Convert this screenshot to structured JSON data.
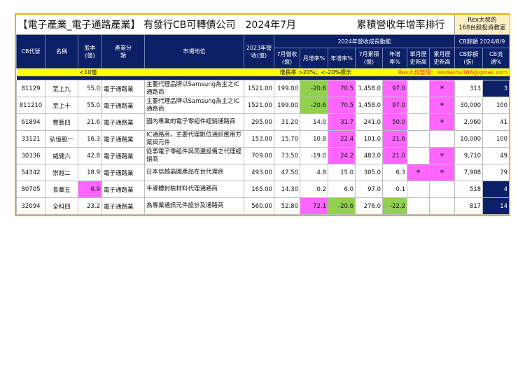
{
  "title": {
    "main": "【電子產業_電子通路產業】 有發行CB可轉債公司",
    "period": "2024年7月",
    "subject": "累積營收年增率排行",
    "brand_line1": "Rex大叔的",
    "brand_line2": "168台股投資教室"
  },
  "headers": {
    "cb_code": "CB代號",
    "name": "名稱",
    "capital": "股本(億)",
    "industry": "產業分類",
    "market": "市場地位",
    "rev2023": "2023年營收(億)",
    "growth_group": "2024年營收成長動能",
    "cb_group": "CB餘額 2024/8/9",
    "jul_rev": "7月營收(億)",
    "mom": "月增率%",
    "yoy": "年增率%",
    "jul_cum": "7月累積(億)",
    "cum_yoy": "年增率%",
    "month_high": "單月歷史新高",
    "cum_high": "累月歷史新高",
    "cb_balance": "CB餘額(張)",
    "cb_ratio": "CB流通%"
  },
  "legend": {
    "small_cap": "<10億",
    "rule": "增長率 >20%；<-20%標示",
    "credit": "Rex大叔整理：rexdashu168@gmail.com"
  },
  "colors": {
    "navy": "#0b2066",
    "magenta": "#ff66ff",
    "green": "#92d050",
    "yellow": "#ffff00",
    "border": "#e3b30c"
  },
  "rows": [
    {
      "code": "81129",
      "name": "至上九",
      "capital": "55.0",
      "industry": "電子通路業",
      "market": "主要代理品牌以Samsung為主之IC通路商",
      "rev2023": "1521.00",
      "jul_rev": "199.00",
      "mom": "-20.6",
      "yoy": "70.5",
      "jul_cum": "1,458.0",
      "cum_yoy": "97.0",
      "month_high": "",
      "cum_high": "*",
      "cb_balance": "313",
      "cb_ratio": "3",
      "hl": {
        "mom": "g",
        "yoy": "m",
        "cum_yoy": "m",
        "cum_high": "m",
        "cb_ratio": "n"
      }
    },
    {
      "code": "811210",
      "name": "至上十",
      "capital": "55.0",
      "industry": "電子通路業",
      "market": "主要代理品牌以Samsung為主之IC通路商",
      "rev2023": "1521.00",
      "jul_rev": "199.00",
      "mom": "-20.6",
      "yoy": "70.5",
      "jul_cum": "1,458.0",
      "cum_yoy": "97.0",
      "month_high": "",
      "cum_high": "*",
      "cb_balance": "30,000",
      "cb_ratio": "100",
      "hl": {
        "mom": "g",
        "yoy": "m",
        "cum_yoy": "m",
        "cum_high": "m"
      }
    },
    {
      "code": "61894",
      "name": "豐藝四",
      "capital": "21.6",
      "industry": "電子通路業",
      "market": "國內專業的電子零組件經銷通路商",
      "rev2023": "295.00",
      "jul_rev": "31.20",
      "mom": "14.0",
      "yoy": "31.7",
      "jul_cum": "241.0",
      "cum_yoy": "50.0",
      "month_high": "",
      "cum_high": "*",
      "cb_balance": "2,060",
      "cb_ratio": "41",
      "hl": {
        "yoy": "m",
        "cum_yoy": "m",
        "cum_high": "m"
      }
    },
    {
      "code": "33121",
      "name": "弘憶股一",
      "capital": "16.3",
      "industry": "電子通路業",
      "market": "IC通路商，主要代理數位通訊應用方案與元件",
      "rev2023": "153.00",
      "jul_rev": "15.70",
      "mom": "10.8",
      "yoy": "22.4",
      "jul_cum": "101.0",
      "cum_yoy": "21.6",
      "month_high": "",
      "cum_high": "",
      "cb_balance": "10,000",
      "cb_ratio": "100",
      "hl": {
        "yoy": "m",
        "cum_yoy": "m"
      }
    },
    {
      "code": "30336",
      "name": "威健六",
      "capital": "42.8",
      "industry": "電子通路業",
      "market": "從事電子零組件與周邊設備之代理經銷商",
      "rev2023": "709.00",
      "jul_rev": "73.50",
      "mom": "-19.0",
      "yoy": "24.2",
      "jul_cum": "483.0",
      "cum_yoy": "21.0",
      "month_high": "",
      "cum_high": "*",
      "cb_balance": "9,710",
      "cb_ratio": "49",
      "hl": {
        "yoy": "m",
        "cum_yoy": "m",
        "cum_high": "m"
      }
    },
    {
      "code": "54342",
      "name": "崇越二",
      "capital": "18.9",
      "industry": "電子通路業",
      "market": "日本信越晶圓產品在台代理商",
      "rev2023": "493.00",
      "jul_rev": "47.50",
      "mom": "4.8",
      "yoy": "15.0",
      "jul_cum": "305.0",
      "cum_yoy": "6.3",
      "month_high": "*",
      "cum_high": "*",
      "cb_balance": "7,908",
      "cb_ratio": "79",
      "hl": {
        "month_high": "m",
        "cum_high": "m"
      }
    },
    {
      "code": "80705",
      "name": "長華五",
      "capital": "6.9",
      "industry": "電子通路業",
      "market": "半導體封裝材料代理通路商",
      "rev2023": "165.00",
      "jul_rev": "14.30",
      "mom": "0.2",
      "yoy": "6.0",
      "jul_cum": "97.0",
      "cum_yoy": "0.1",
      "month_high": "",
      "cum_high": "",
      "cb_balance": "518",
      "cb_ratio": "4",
      "hl": {
        "capital": "m",
        "cb_ratio": "n"
      }
    },
    {
      "code": "32094",
      "name": "全科四",
      "capital": "23.2",
      "industry": "電子通路業",
      "market": "為專業通訊元件設計及通路商",
      "rev2023": "560.00",
      "jul_rev": "52.80",
      "mom": "72.1",
      "yoy": "-20.6",
      "jul_cum": "276.0",
      "cum_yoy": "-22.2",
      "month_high": "",
      "cum_high": "",
      "cb_balance": "817",
      "cb_ratio": "14",
      "hl": {
        "mom": "m",
        "yoy": "g",
        "cum_yoy": "g",
        "cb_ratio": "n"
      }
    }
  ]
}
